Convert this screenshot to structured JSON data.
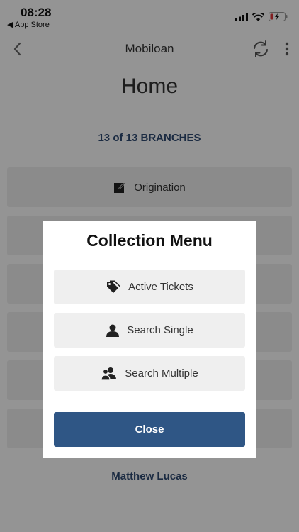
{
  "status_bar": {
    "time": "08:28",
    "back_app": "◀ App Store"
  },
  "nav": {
    "title": "Mobiloan"
  },
  "page": {
    "title": "Home",
    "branches": "13 of 13 BRANCHES",
    "origination_label": "Origination",
    "user_name": "Matthew Lucas"
  },
  "modal": {
    "title": "Collection Menu",
    "buttons": [
      {
        "label": "Active Tickets",
        "icon": "tag-icon"
      },
      {
        "label": "Search Single",
        "icon": "person-icon"
      },
      {
        "label": "Search Multiple",
        "icon": "people-icon"
      }
    ],
    "close_label": "Close"
  },
  "colors": {
    "accent": "#2f5685",
    "branch_text": "#2f4a73",
    "tile_bg": "#efefef",
    "battery_low": "#e0343a"
  }
}
